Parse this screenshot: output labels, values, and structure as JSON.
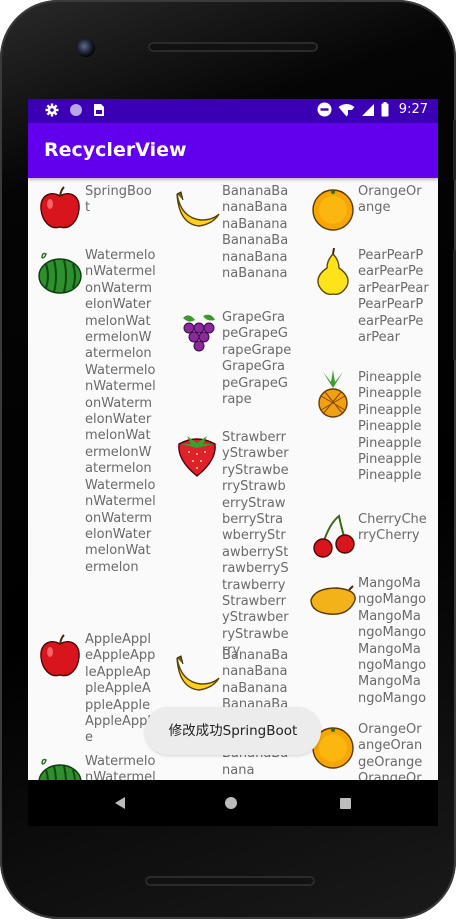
{
  "status_bar": {
    "time": "9:27",
    "left_icons": [
      "gear-icon",
      "circle-icon",
      "sim-card-icon"
    ],
    "right_icons": [
      "do-not-disturb-icon",
      "wifi-icon",
      "signal-icon",
      "battery-icon"
    ]
  },
  "app_bar": {
    "title": "RecyclerView"
  },
  "fruit_list": {
    "items": [
      {
        "name": "SpringBoot",
        "icon": "apple-icon"
      },
      {
        "name": "BananaBananaBananaBananaBananaBananaBananaBanana",
        "icon": "banana-icon"
      },
      {
        "name": "OrangeOrange",
        "icon": "orange-icon"
      },
      {
        "name": "WatermelonWatermelonWatermelonWatermelonWatermelonWatermelonWatermelonWatermelonWatermelonWatermelonWatermelonWatermelonWatermelonWatermelonWatermelonWatermelonWatermelon",
        "icon": "watermelon-icon"
      },
      {
        "name": "GrapeGrapeGrapeGrapeGrapeGrapeGrapeGrapeGrape",
        "icon": "grape-icon"
      },
      {
        "name": "PearPearPearPearPearPearPearPearPearPearPearPearPear",
        "icon": "pear-icon"
      },
      {
        "name": "StrawberryStrawberryStrawberryStrawberryStrawberryStrawberryStrawberryStrawberryStrawberryStrawberryStrawberryStrawberry",
        "icon": "strawberry-icon"
      },
      {
        "name": "PineapplePineapplePineapplePineapplePineapplePineapplePineapple",
        "icon": "pineapple-icon"
      },
      {
        "name": "CherryCherryCherry",
        "icon": "cherry-icon"
      },
      {
        "name": "MangoMangoMangoMangoMangoMangoMangoMangoMangoMangoMangoMango",
        "icon": "mango-icon"
      },
      {
        "name": "AppleAppleAppleAppleAppleAppleAppleAppleAppleAppleApple",
        "icon": "apple-icon"
      },
      {
        "name": "BananaBananaBananaBananaBananaBananaBananaBananaBananaBanana",
        "icon": "banana-icon"
      },
      {
        "name": "WatermelonWatermel",
        "icon": "watermelon-icon"
      },
      {
        "name": "OrangeOrangeOrangeOrangeOrangeOrangeOrange",
        "icon": "orange-icon"
      }
    ]
  },
  "toast": {
    "message": "修改成功SpringBoot"
  },
  "nav_bar": {
    "icons": [
      "back-icon",
      "home-icon",
      "recent-apps-icon"
    ]
  }
}
